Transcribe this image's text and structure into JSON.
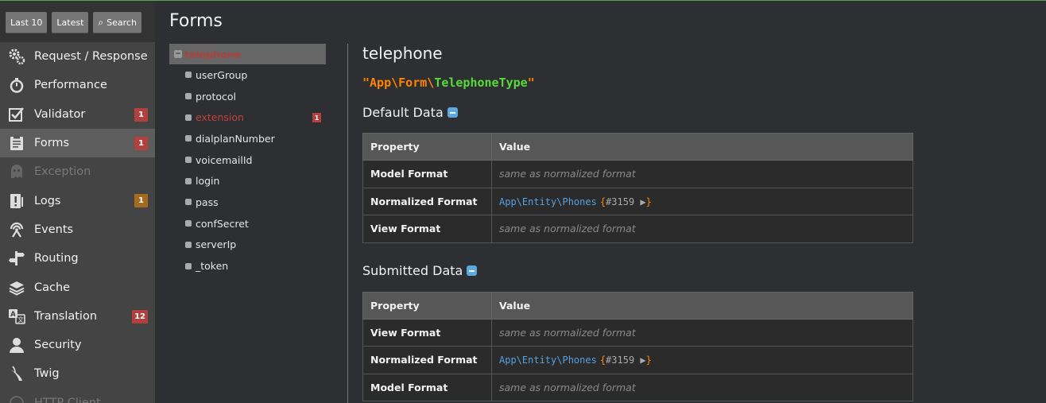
{
  "toolbar": {
    "last10": "Last 10",
    "latest": "Latest",
    "search": "Search"
  },
  "menu": [
    {
      "label": "Request / Response",
      "icon": "gears-icon"
    },
    {
      "label": "Performance",
      "icon": "stopwatch-icon"
    },
    {
      "label": "Validator",
      "icon": "checkbox-icon",
      "badge": "1"
    },
    {
      "label": "Forms",
      "icon": "clipboard-icon",
      "badge": "1"
    },
    {
      "label": "Exception",
      "icon": "ghost-icon"
    },
    {
      "label": "Logs",
      "icon": "log-icon",
      "badge": "1"
    },
    {
      "label": "Events",
      "icon": "broadcast-icon"
    },
    {
      "label": "Routing",
      "icon": "signpost-icon"
    },
    {
      "label": "Cache",
      "icon": "layers-icon"
    },
    {
      "label": "Translation",
      "icon": "translate-icon",
      "badge": "12"
    },
    {
      "label": "Security",
      "icon": "user-icon"
    },
    {
      "label": "Twig",
      "icon": "twig-icon"
    },
    {
      "label": "HTTP Client",
      "icon": "http-icon"
    }
  ],
  "page": {
    "title": "Forms"
  },
  "tree": {
    "root": "telephone",
    "children": [
      "userGroup",
      "protocol",
      "extension",
      "dialplanNumber",
      "voicemailId",
      "login",
      "pass",
      "confSecret",
      "serverIp",
      "_token"
    ],
    "error_badge": "1"
  },
  "detail": {
    "title": "telephone",
    "class_prefix": "App\\Form\\",
    "class_short": "TelephoneType",
    "default_title": "Default Data",
    "submitted_title": "Submitted Data",
    "col_property": "Property",
    "col_value": "Value",
    "default_rows": [
      {
        "key": "Model Format",
        "value": "same as normalized format"
      },
      {
        "key": "Normalized Format",
        "cls": "App\\Entity\\Phones",
        "ref": "#3159"
      },
      {
        "key": "View Format",
        "value": "same as normalized format"
      }
    ],
    "submitted_rows": [
      {
        "key": "View Format",
        "value": "same as normalized format"
      },
      {
        "key": "Normalized Format",
        "cls": "App\\Entity\\Phones",
        "ref": "#3159"
      },
      {
        "key": "Model Format",
        "value": "same as normalized format"
      }
    ]
  },
  "colors": {
    "accent_error": "#b0413e",
    "warning": "#a46a1f",
    "class_name": "#56db3a",
    "namespace": "#ff8400",
    "link": "#56a1e0"
  }
}
